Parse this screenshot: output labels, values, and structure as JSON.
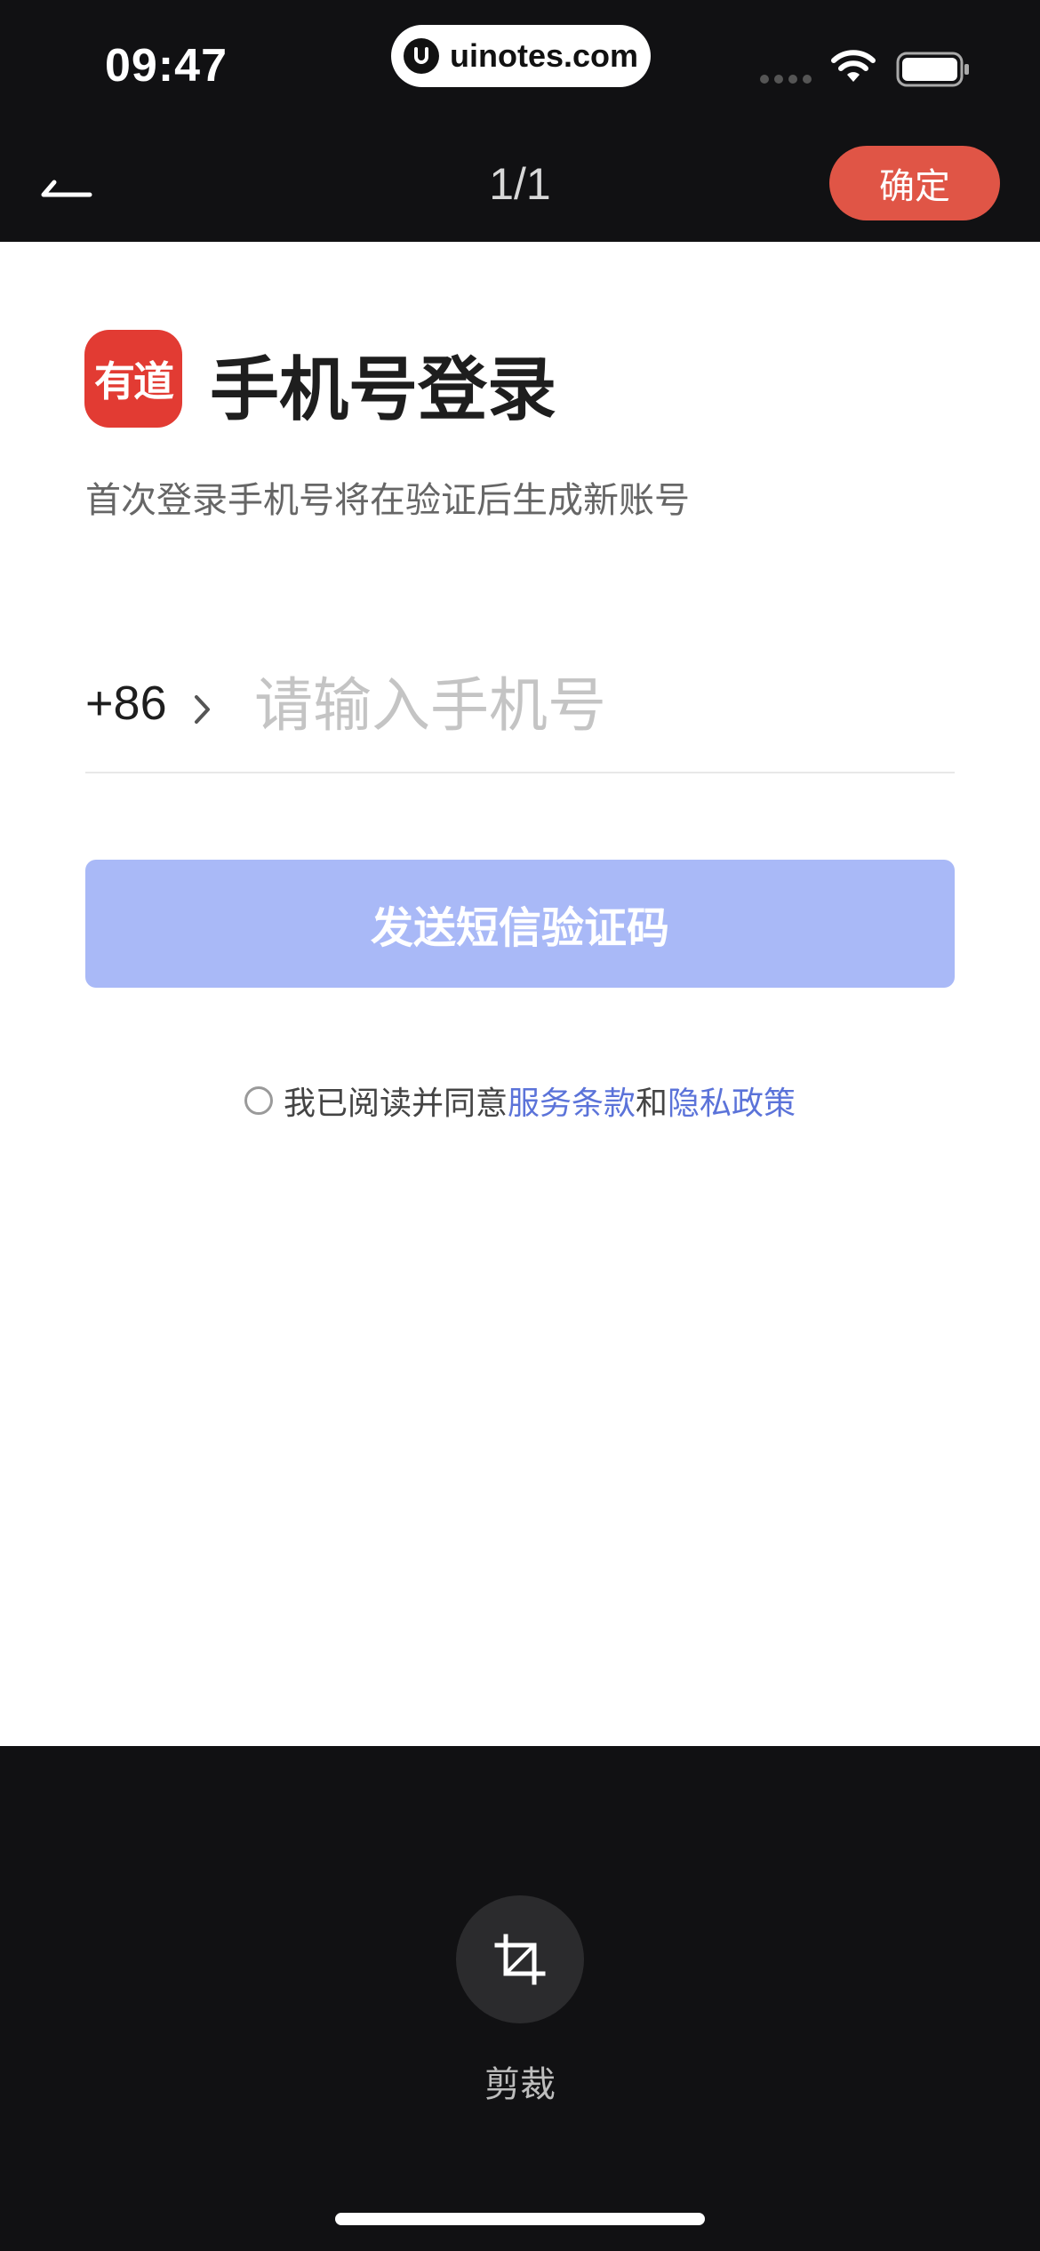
{
  "status_bar": {
    "time": "09:47",
    "site": "uinotes.com"
  },
  "header": {
    "page_counter": "1/1",
    "confirm_label": "确定"
  },
  "login": {
    "logo_text": "有道",
    "title": "手机号登录",
    "subtitle": "首次登录手机号将在验证后生成新账号",
    "country_code": "+86",
    "phone_placeholder": "请输入手机号",
    "send_code_label": "发送短信验证码",
    "agreement_prefix": "我已阅读并同意",
    "terms_link": "服务条款",
    "agreement_and": "和",
    "privacy_link": "隐私政策"
  },
  "toolbar": {
    "crop_label": "剪裁"
  },
  "colors": {
    "confirm_button": "#e05546",
    "send_button_disabled": "#a9b9f7",
    "link": "#5b73d9",
    "logo": "#e23b33"
  },
  "icons": [
    "back-arrow-icon",
    "wifi-icon",
    "battery-icon",
    "chevron-right-icon",
    "crop-icon"
  ]
}
